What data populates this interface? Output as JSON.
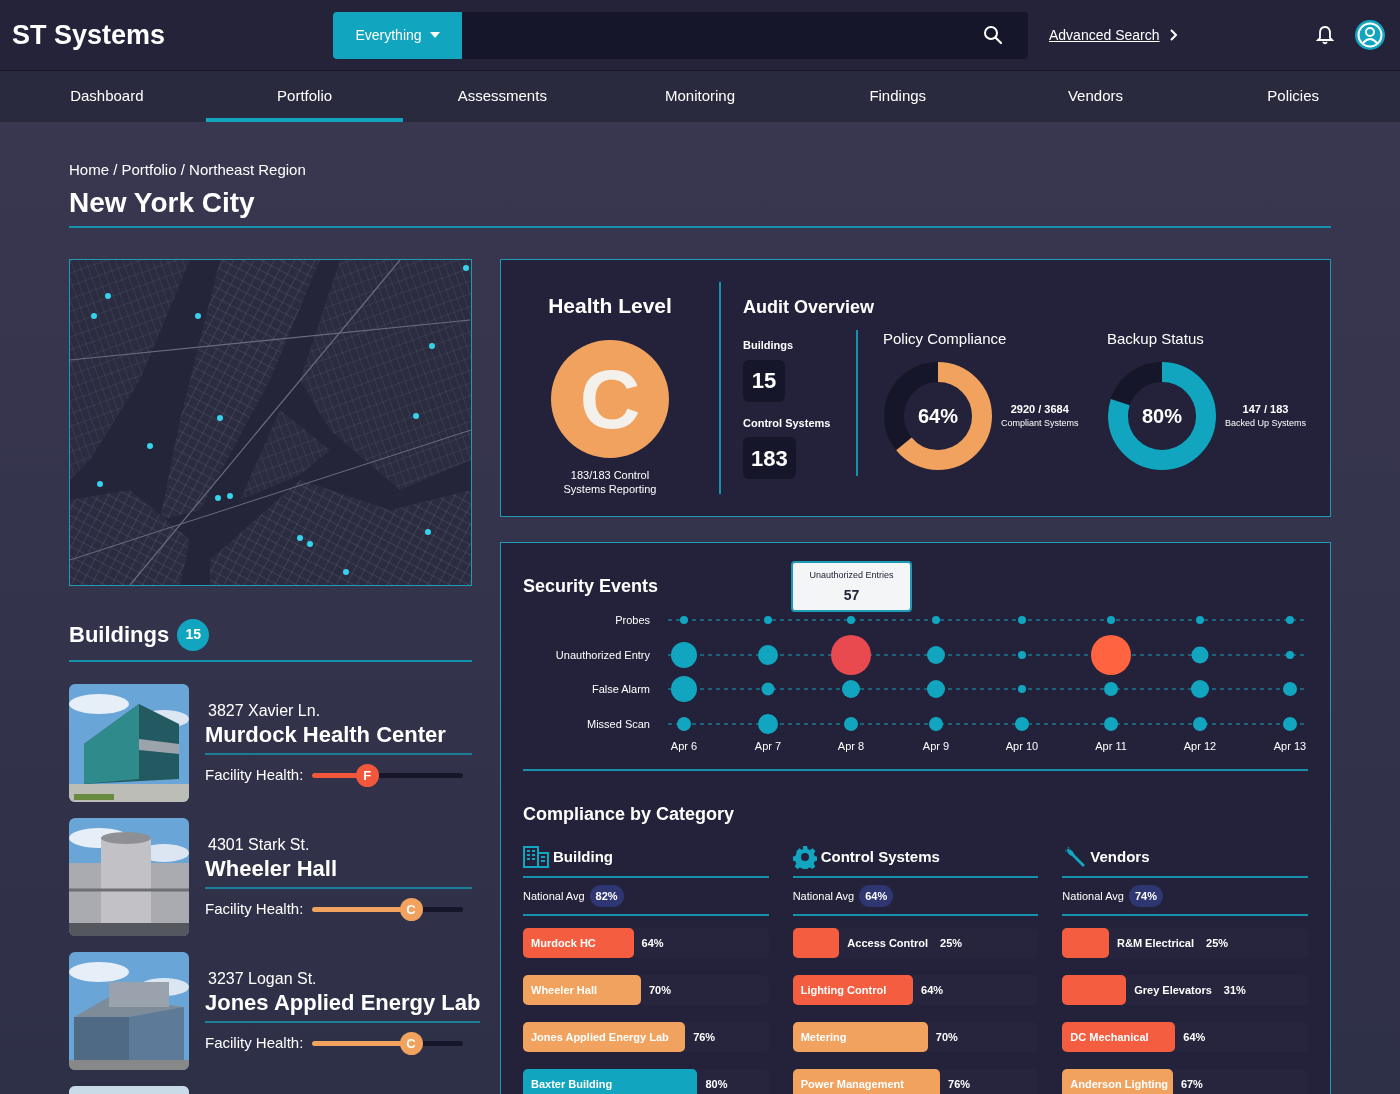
{
  "header": {
    "logo": "ST Systems",
    "search_scope": "Everything",
    "advanced_search": "Advanced Search"
  },
  "nav": [
    {
      "label": "Dashboard",
      "selected": false
    },
    {
      "label": "Portfolio",
      "selected": true
    },
    {
      "label": "Assessments",
      "selected": false
    },
    {
      "label": "Monitoring",
      "selected": false
    },
    {
      "label": "Findings",
      "selected": false
    },
    {
      "label": "Vendors",
      "selected": false
    },
    {
      "label": "Policies",
      "selected": false
    }
  ],
  "breadcrumb": "Home / Portfolio / Northeast Region",
  "title": "New York City",
  "buildings": {
    "title": "Buildings",
    "count": "15",
    "items": [
      {
        "address": "3827 Xavier Ln.",
        "name": "Murdock Health Center",
        "health_label": "Facility Health:",
        "grade": "F",
        "level": 0.36,
        "color": "#f2573c"
      },
      {
        "address": "4301 Stark St.",
        "name": "Wheeler Hall",
        "health_label": "Facility Health:",
        "grade": "C",
        "level": 0.65,
        "color": "#f0a25e"
      },
      {
        "address": "3237 Logan St.",
        "name": "Jones Applied Energy Lab",
        "health_label": "Facility Health:",
        "grade": "C",
        "level": 0.65,
        "color": "#f0a25e"
      }
    ]
  },
  "health": {
    "title": "Health Level",
    "grade": "C",
    "color": "#f0a25e",
    "caption": "183/183 Control Systems Reporting"
  },
  "audit": {
    "title": "Audit Overview",
    "stats": [
      {
        "label": "Buildings",
        "value": "15"
      },
      {
        "label": "Control Systems",
        "value": "183"
      }
    ],
    "donuts": [
      {
        "title": "Policy Compliance",
        "percent": "64%",
        "level": 0.64,
        "color": "#f0a25e",
        "count": "2920 / 3684",
        "caption": "Compliant Systems"
      },
      {
        "title": "Backup Status",
        "percent": "80%",
        "level": 0.8,
        "color": "#12a5bf",
        "count": "147 / 183",
        "caption": "Backed Up Systems"
      }
    ]
  },
  "security_events": {
    "title": "Security Events",
    "dates": [
      "Apr 6",
      "Apr 7",
      "Apr 8",
      "Apr 9",
      "Apr 10",
      "Apr 11",
      "Apr 12",
      "Apr 13"
    ],
    "rows": [
      {
        "label": "Probes"
      },
      {
        "label": "Unauthorized Entry"
      },
      {
        "label": "False Alarm"
      },
      {
        "label": "Missed Scan"
      }
    ],
    "tooltip": {
      "title": "Unauthorized Entries",
      "value": "57"
    }
  },
  "compliance": {
    "title": "Compliance by Category",
    "categories": [
      {
        "kind": "building",
        "name": "Building",
        "avg_label": "National Avg",
        "avg": "82%",
        "bars": [
          {
            "label": "Murdock HC",
            "value": "64%",
            "level": 0.45,
            "color": "#f45d3f",
            "kind": "inside"
          },
          {
            "label": "Wheeler Hall",
            "value": "70%",
            "level": 0.48,
            "color": "#f0a25e",
            "kind": "inside"
          },
          {
            "label": "Jones Applied Energy Lab",
            "value": "76%",
            "level": 0.66,
            "color": "#f0a25e",
            "kind": "inside"
          },
          {
            "label": "Baxter Building",
            "value": "80%",
            "level": 0.71,
            "color": "#12a5bf",
            "kind": "inside"
          }
        ]
      },
      {
        "kind": "gear",
        "name": "Control Systems",
        "avg_label": "National Avg",
        "avg": "64%",
        "bars": [
          {
            "label": "Access Control",
            "value": "25%",
            "level": 0.19,
            "color": "#f45d3f",
            "kind": "outside"
          },
          {
            "label": "Lighting Control",
            "value": "64%",
            "level": 0.49,
            "color": "#f45d3f",
            "kind": "inside"
          },
          {
            "label": "Metering",
            "value": "70%",
            "level": 0.55,
            "color": "#f0a25e",
            "kind": "inside"
          },
          {
            "label": "Power Management",
            "value": "76%",
            "level": 0.6,
            "color": "#f0a25e",
            "kind": "inside"
          }
        ]
      },
      {
        "kind": "wrench",
        "name": "Vendors",
        "avg_label": "National Avg",
        "avg": "74%",
        "bars": [
          {
            "label": "R&M Electrical",
            "value": "25%",
            "level": 0.19,
            "color": "#f45d3f",
            "kind": "outside"
          },
          {
            "label": "Grey Elevators",
            "value": "31%",
            "level": 0.26,
            "color": "#f45d3f",
            "kind": "outside"
          },
          {
            "label": "DC Mechanical",
            "value": "64%",
            "level": 0.46,
            "color": "#f45d3f",
            "kind": "inside"
          },
          {
            "label": "Anderson Lighting",
            "value": "67%",
            "level": 0.45,
            "color": "#f0a25e",
            "kind": "inside"
          }
        ]
      }
    ]
  }
}
